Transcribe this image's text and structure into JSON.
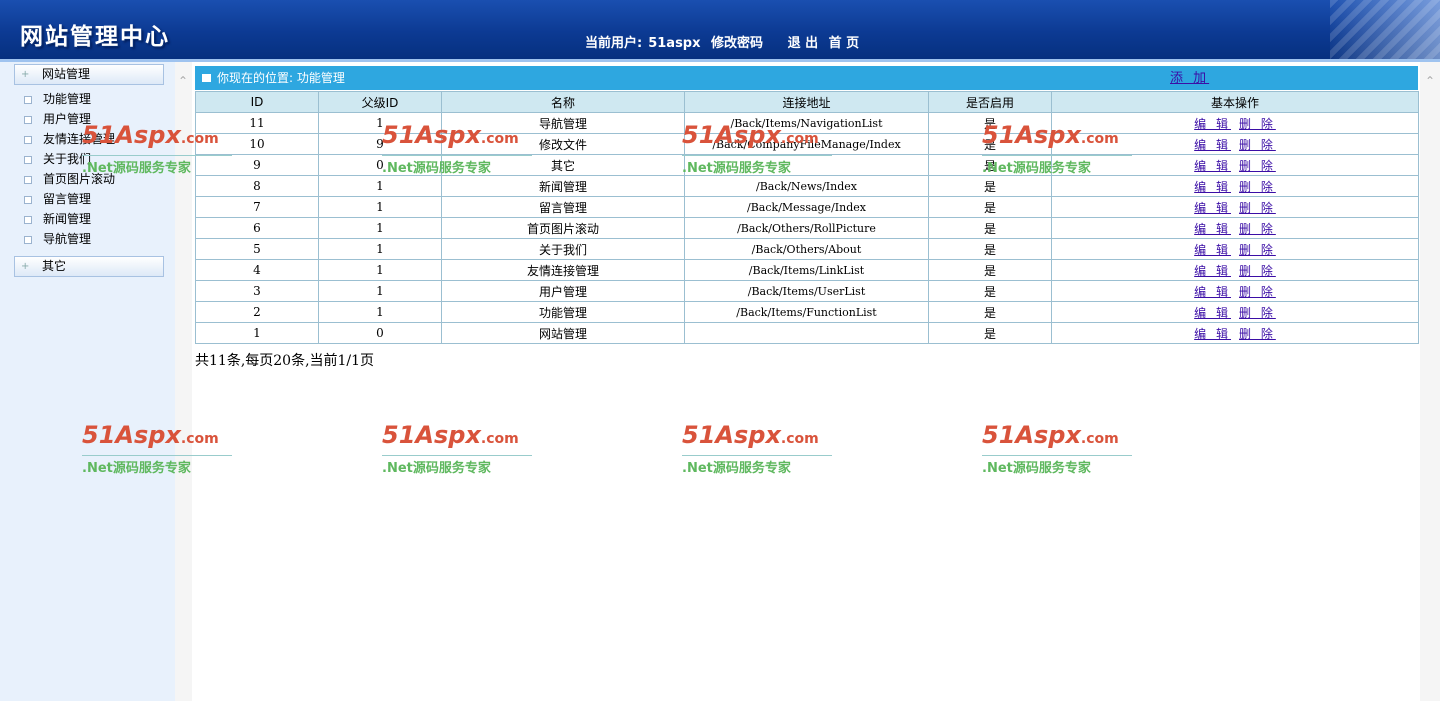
{
  "header": {
    "logo_text": "网站管理中心",
    "current_user_label": "当前用户:",
    "username": "51aspx",
    "change_password": "修改密码",
    "logout": "退 出",
    "home": "首 页"
  },
  "sidebar": {
    "groups": [
      {
        "label": "网站管理",
        "items": [
          "功能管理",
          "用户管理",
          "友情连接管理",
          "关于我们",
          "首页图片滚动",
          "留言管理",
          "新闻管理",
          "导航管理"
        ]
      },
      {
        "label": "其它"
      }
    ]
  },
  "location": {
    "text": "你现在的位置: 功能管理",
    "add_label": "添 加"
  },
  "table": {
    "headers": [
      "ID",
      "父级ID",
      "名称",
      "连接地址",
      "是否启用",
      "基本操作"
    ],
    "edit_label": "编 辑",
    "delete_label": "删 除",
    "rows": [
      {
        "id": "11",
        "parent": "1",
        "name": "导航管理",
        "url": "/Back/Items/NavigationList",
        "enabled": "是"
      },
      {
        "id": "10",
        "parent": "9",
        "name": "修改文件",
        "url": "/Back/CompanyFileManage/Index",
        "enabled": "是"
      },
      {
        "id": "9",
        "parent": "0",
        "name": "其它",
        "url": "",
        "enabled": "是"
      },
      {
        "id": "8",
        "parent": "1",
        "name": "新闻管理",
        "url": "/Back/News/Index",
        "enabled": "是"
      },
      {
        "id": "7",
        "parent": "1",
        "name": "留言管理",
        "url": "/Back/Message/Index",
        "enabled": "是"
      },
      {
        "id": "6",
        "parent": "1",
        "name": "首页图片滚动",
        "url": "/Back/Others/RollPicture",
        "enabled": "是"
      },
      {
        "id": "5",
        "parent": "1",
        "name": "关于我们",
        "url": "/Back/Others/About",
        "enabled": "是"
      },
      {
        "id": "4",
        "parent": "1",
        "name": "友情连接管理",
        "url": "/Back/Items/LinkList",
        "enabled": "是"
      },
      {
        "id": "3",
        "parent": "1",
        "name": "用户管理",
        "url": "/Back/Items/UserList",
        "enabled": "是"
      },
      {
        "id": "2",
        "parent": "1",
        "name": "功能管理",
        "url": "/Back/Items/FunctionList",
        "enabled": "是"
      },
      {
        "id": "1",
        "parent": "0",
        "name": "网站管理",
        "url": "",
        "enabled": "是"
      }
    ]
  },
  "pager": {
    "text": "共11条,每页20条,当前1/1页"
  },
  "watermark": {
    "brand": "51Aspx",
    "suffix": ".com",
    "tagline": ".Net源码服务专家"
  },
  "colors": {
    "header_blue": "#0c3a93",
    "location_bar": "#2ea7e0",
    "table_header": "#cfe8f1",
    "link": "#3b0ea6",
    "watermark_red": "#d9533b",
    "watermark_green": "#5fb85f"
  }
}
